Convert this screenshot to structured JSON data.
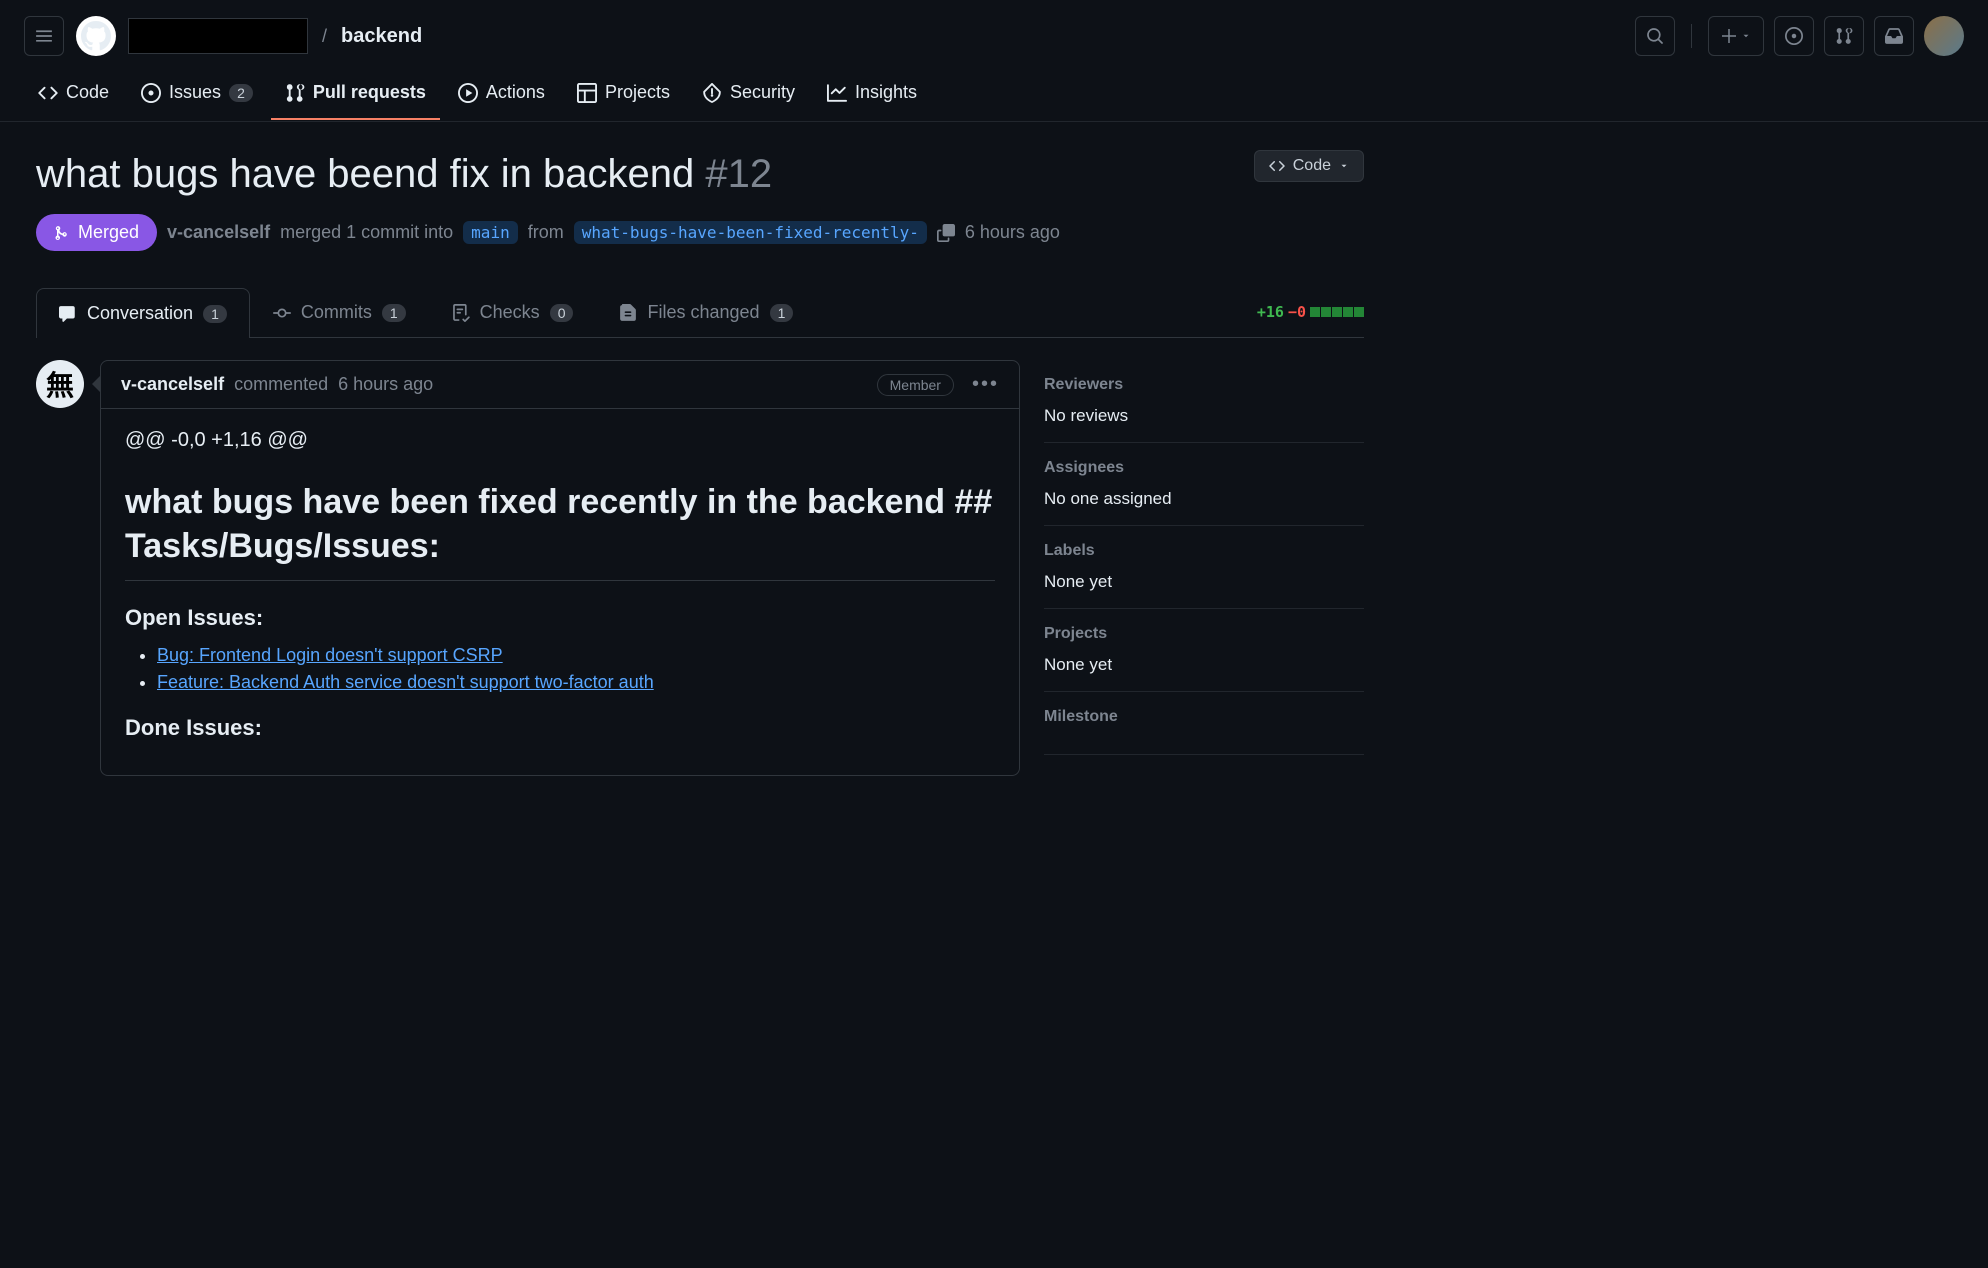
{
  "header": {
    "repo_name": "backend",
    "separator": "/"
  },
  "nav": {
    "code": "Code",
    "issues": "Issues",
    "issues_count": "2",
    "pulls": "Pull requests",
    "actions": "Actions",
    "projects": "Projects",
    "security": "Security",
    "insights": "Insights"
  },
  "pr": {
    "title": "what bugs have beend fix in backend ",
    "number": "#12",
    "code_btn": "Code",
    "status": "Merged",
    "author": "v-cancelself",
    "merge_text_1": " merged 1 commit into ",
    "base_branch": "main",
    "merge_text_2": " from ",
    "head_branch": "what-bugs-have-been-fixed-recently-",
    "timestamp": "6 hours ago"
  },
  "tabs": {
    "conversation": "Conversation",
    "conversation_count": "1",
    "commits": "Commits",
    "commits_count": "1",
    "checks": "Checks",
    "checks_count": "0",
    "files": "Files changed",
    "files_count": "1",
    "additions": "+16",
    "deletions": "−0"
  },
  "comment": {
    "author": "v-cancelself",
    "action": " commented ",
    "time": "6 hours ago",
    "badge": "Member",
    "diff_header": "@@ -0,0 +1,16 @@",
    "body_title": "what bugs have been fixed recently in the backend ## Tasks/Bugs/Issues:",
    "open_heading": "Open Issues:",
    "open_issues": [
      "Bug: Frontend Login doesn't support CSRP",
      "Feature: Backend Auth service doesn't support two-factor auth"
    ],
    "done_heading": "Done Issues:"
  },
  "sidebar": {
    "reviewers_h": "Reviewers",
    "reviewers_v": "No reviews",
    "assignees_h": "Assignees",
    "assignees_v": "No one assigned",
    "labels_h": "Labels",
    "labels_v": "None yet",
    "projects_h": "Projects",
    "projects_v": "None yet",
    "milestone_h": "Milestone"
  }
}
